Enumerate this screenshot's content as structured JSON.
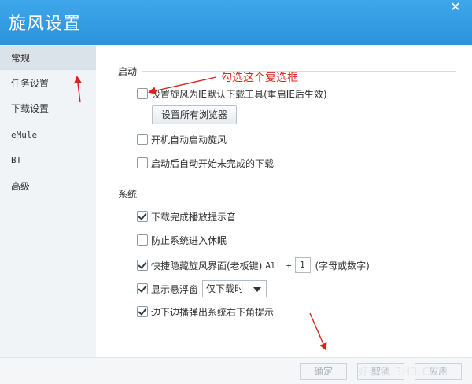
{
  "window": {
    "title": "旋风设置",
    "close_symbol": "✕"
  },
  "sidebar": {
    "items": [
      {
        "label": "常规",
        "active": true
      },
      {
        "label": "任务设置"
      },
      {
        "label": "下载设置"
      },
      {
        "label": "eMule"
      },
      {
        "label": "BT"
      },
      {
        "label": "高级"
      }
    ]
  },
  "startup": {
    "section_label": "启动",
    "set_default_label": "设置旋风为IE默认下载工具(重启IE后生效)",
    "set_default_checked": false,
    "browsers_button": "设置所有浏览器",
    "autostart_label": "开机自动启动旋风",
    "autostart_checked": false,
    "resume_label": "启动后自动开始未完成的下载",
    "resume_checked": false
  },
  "system": {
    "section_label": "系统",
    "sound_label": "下载完成播放提示音",
    "sound_checked": true,
    "sleep_label": "防止系统进入休眠",
    "sleep_checked": false,
    "hide_label": "快捷隐藏旋风界面(老板键)",
    "hide_checked": true,
    "hotkey_prefix": "Alt +",
    "hotkey_value": "1",
    "hotkey_hint": "(字母或数字)",
    "float_label": "显示悬浮窗",
    "float_checked": true,
    "float_option": "仅下载时",
    "popup_label": "边下边播弹出系统右下角提示",
    "popup_checked": true
  },
  "footer": {
    "ok": "确定",
    "cancel": "取消",
    "apply": "应用"
  },
  "annotation": {
    "text": "勾选这个复选框",
    "color": "#d9231f"
  },
  "watermark": {
    "text": "好装机 3H3.COM"
  },
  "colors": {
    "title_bar": "#2b93dc",
    "sidebar_bg": "#f1f4f7",
    "annotation": "#d9231f"
  }
}
